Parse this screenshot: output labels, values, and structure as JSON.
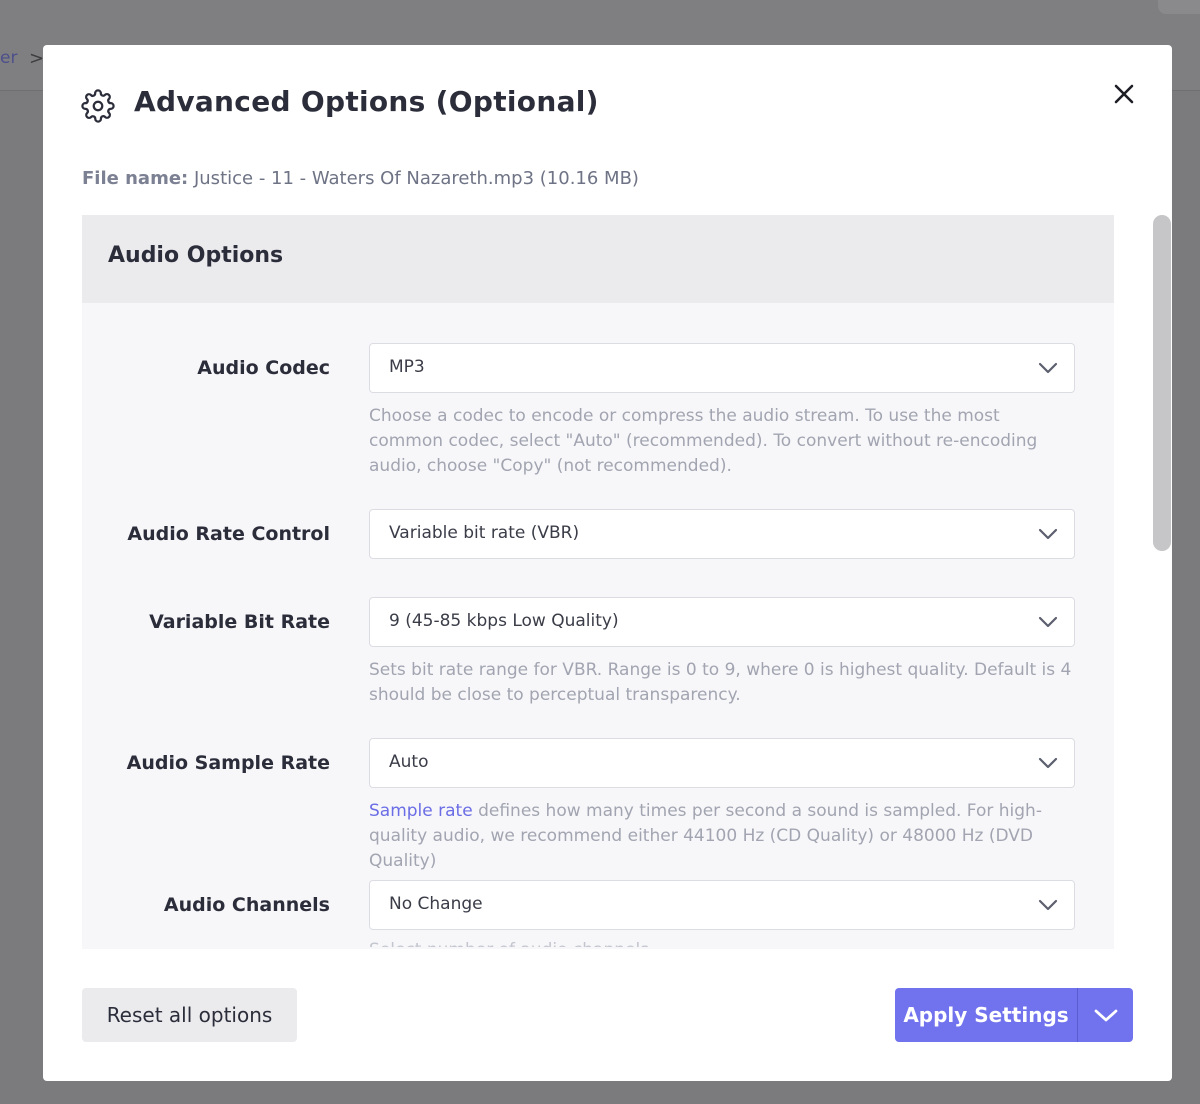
{
  "background": {
    "breadcrumb_fragment": "er",
    "breadcrumb_separator": ">"
  },
  "modal": {
    "title": "Advanced Options (Optional)",
    "title_icon": "gear-icon",
    "close_icon": "close-icon",
    "file_label": "File name:",
    "file_value": "Justice - 11 - Waters Of Nazareth.mp3 (10.16 MB)"
  },
  "audio_options": {
    "heading": "Audio Options",
    "fields": [
      {
        "label": "Audio Codec",
        "value": "MP3",
        "help": "Choose a codec to encode or compress the audio stream. To use the most common codec, select \"Auto\" (recommended). To convert without re-encoding audio, choose \"Copy\" (not recommended)."
      },
      {
        "label": "Audio Rate Control",
        "value": "Variable bit rate (VBR)"
      },
      {
        "label": "Variable Bit Rate",
        "value": "9 (45-85 kbps Low Quality)",
        "help": "Sets bit rate range for VBR. Range is 0 to 9, where 0 is highest quality. Default is 4 should be close to perceptual transparency."
      },
      {
        "label": "Audio Sample Rate",
        "value": "Auto",
        "help_link": "Sample rate",
        "help": " defines how many times per second a sound is sampled. For high-quality audio, we recommend either 44100 Hz (CD Quality) or 48000 Hz (DVD Quality)"
      },
      {
        "label": "Audio Channels",
        "value": "No Change",
        "help_partial": "Select number of audio channels"
      }
    ]
  },
  "footer": {
    "reset_label": "Reset all options",
    "apply_label": "Apply Settings",
    "apply_dropdown_icon": "chevron-down-icon"
  },
  "colors": {
    "accent": "#7172ed",
    "link": "#6a6de5",
    "overlay": "#7b7b7d"
  }
}
